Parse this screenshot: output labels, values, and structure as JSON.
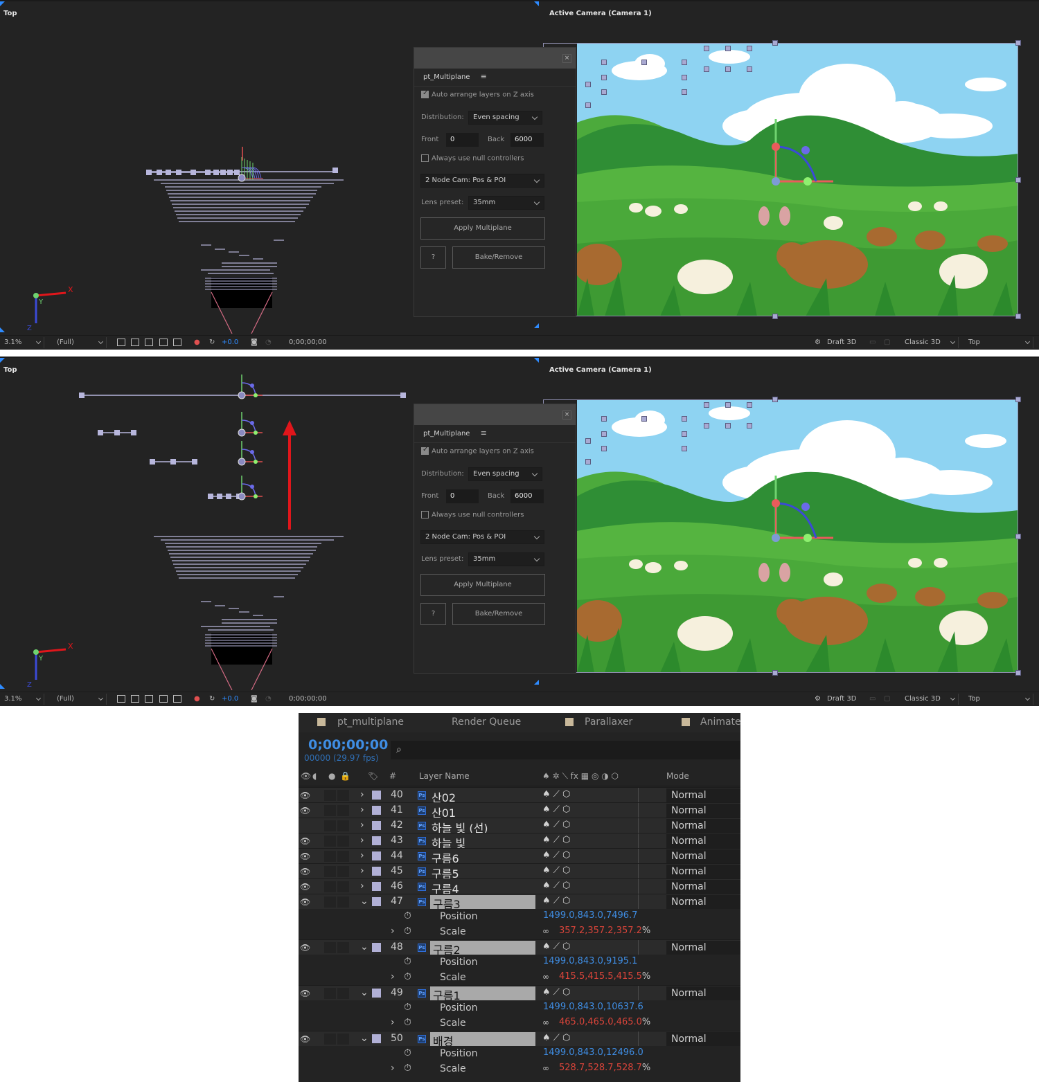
{
  "viewer": {
    "top_view_label": "Top",
    "camera_view_label": "Active Camera (Camera 1)"
  },
  "panel": {
    "tab_title": "pt_Multiplane",
    "menu_icon": "hamburger-menu-icon",
    "close_icon": "×",
    "auto_arrange_label": "Auto arrange layers on Z axis",
    "auto_arrange_checked": true,
    "distribution_label": "Distribution:",
    "distribution_value": "Even spacing",
    "front_label": "Front",
    "front_value": "0",
    "back_label": "Back",
    "back_value": "6000",
    "null_controllers_label": "Always use null controllers",
    "null_controllers_checked": false,
    "camera_type": "2 Node Cam: Pos & POI",
    "lens_label": "Lens preset:",
    "lens_value": "35mm",
    "apply_label": "Apply Multiplane",
    "help_label": "?",
    "bake_label": "Bake/Remove"
  },
  "toolbar": {
    "zoom": "3.1%",
    "resolution": "(Full)",
    "exposure": "+0.0",
    "timecode": "0;00;00;00",
    "draft_label": "Draft 3D",
    "renderer": "Classic 3D",
    "view": "Top"
  },
  "axis": {
    "x": "X",
    "y": "Y",
    "z": "Z"
  },
  "timeline": {
    "tabs": [
      "pt_multiplane",
      "Render Queue",
      "Parallaxer",
      "Animate"
    ],
    "timecode": "0;00;00;00",
    "fps": "00000 (29.97 fps)",
    "search_icon": "⌕",
    "col_number": "#",
    "col_layer_name": "Layer Name",
    "col_mode": "Mode",
    "layers": [
      {
        "num": "40",
        "name": "산02",
        "mode": "Normal",
        "visible": true,
        "expanded": false,
        "selected": false
      },
      {
        "num": "41",
        "name": "산01",
        "mode": "Normal",
        "visible": true,
        "expanded": false,
        "selected": false
      },
      {
        "num": "42",
        "name": "하늘 빛 (선)",
        "mode": "Normal",
        "visible": false,
        "expanded": false,
        "selected": false
      },
      {
        "num": "43",
        "name": "하늘 빛",
        "mode": "Normal",
        "visible": true,
        "expanded": false,
        "selected": false
      },
      {
        "num": "44",
        "name": "구름6",
        "mode": "Normal",
        "visible": true,
        "expanded": false,
        "selected": false
      },
      {
        "num": "45",
        "name": "구름5",
        "mode": "Normal",
        "visible": true,
        "expanded": false,
        "selected": false
      },
      {
        "num": "46",
        "name": "구름4",
        "mode": "Normal",
        "visible": true,
        "expanded": false,
        "selected": false
      },
      {
        "num": "47",
        "name": "구름3",
        "mode": "Normal",
        "visible": true,
        "expanded": true,
        "selected": true,
        "position": "1499.0,843.0,7496.7",
        "scale": "357.2,357.2,357.2"
      },
      {
        "num": "48",
        "name": "구름2",
        "mode": "Normal",
        "visible": true,
        "expanded": true,
        "selected": true,
        "position": "1499.0,843.0,9195.1",
        "scale": "415.5,415.5,415.5"
      },
      {
        "num": "49",
        "name": "구름1",
        "mode": "Normal",
        "visible": true,
        "expanded": true,
        "selected": true,
        "position": "1499.0,843.0,10637.6",
        "scale": "465.0,465.0,465.0"
      },
      {
        "num": "50",
        "name": "배경",
        "mode": "Normal",
        "visible": true,
        "expanded": true,
        "selected": true,
        "position": "1499.0,843.0,12496.0",
        "scale": "528.7,528.7,528.7"
      }
    ],
    "position_label": "Position",
    "scale_label": "Scale",
    "percent": "%"
  },
  "colors": {
    "bg": "#232323",
    "accent_blue": "#2e8bff",
    "value_blue": "#3f8de3",
    "value_red": "#d9443a",
    "label_lavender": "#b1b0d6",
    "arrow_red": "#e0161b"
  }
}
